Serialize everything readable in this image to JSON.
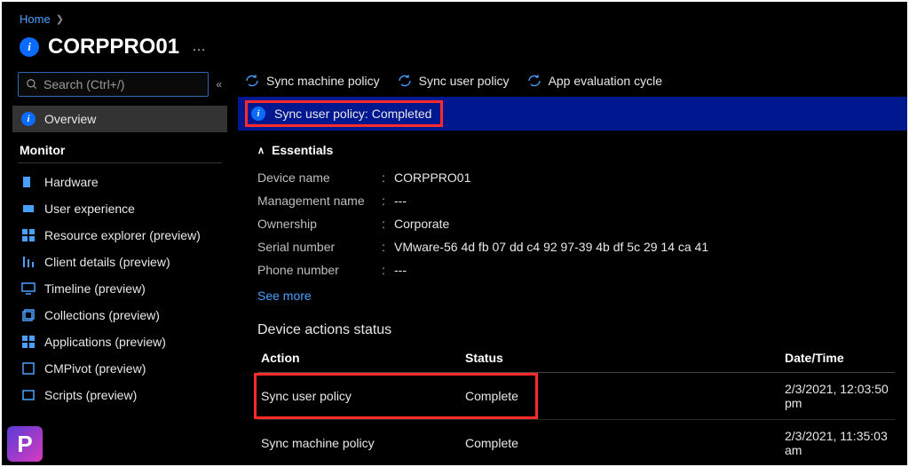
{
  "breadcrumb": {
    "home": "Home"
  },
  "page": {
    "title": "CORPPRO01"
  },
  "sidebar": {
    "search_placeholder": "Search (Ctrl+/)",
    "overview": "Overview",
    "monitor_header": "Monitor",
    "items": [
      {
        "label": "Hardware"
      },
      {
        "label": "User experience"
      },
      {
        "label": "Resource explorer (preview)"
      },
      {
        "label": "Client details (preview)"
      },
      {
        "label": "Timeline (preview)"
      },
      {
        "label": "Collections (preview)"
      },
      {
        "label": "Applications (preview)"
      },
      {
        "label": "CMPivot (preview)"
      },
      {
        "label": "Scripts (preview)"
      }
    ]
  },
  "actions": {
    "sync_machine": "Sync machine policy",
    "sync_user": "Sync user policy",
    "app_eval": "App evaluation cycle"
  },
  "notification": "Sync user policy: Completed",
  "essentials": {
    "header": "Essentials",
    "rows": [
      {
        "k": "Device name",
        "v": "CORPPRO01"
      },
      {
        "k": "Management name",
        "v": "---"
      },
      {
        "k": "Ownership",
        "v": "Corporate"
      },
      {
        "k": "Serial number",
        "v": "VMware-56 4d fb 07 dd c4 92 97-39 4b df 5c 29 14 ca 41"
      },
      {
        "k": "Phone number",
        "v": "---"
      }
    ],
    "see_more": "See more"
  },
  "device_actions": {
    "title": "Device actions status",
    "headers": {
      "action": "Action",
      "status": "Status",
      "datetime": "Date/Time"
    },
    "rows": [
      {
        "action": "Sync user policy",
        "status": "Complete",
        "dt": "2/3/2021, 12:03:50 pm"
      },
      {
        "action": "Sync machine policy",
        "status": "Complete",
        "dt": "2/3/2021, 11:35:03 am"
      }
    ]
  }
}
